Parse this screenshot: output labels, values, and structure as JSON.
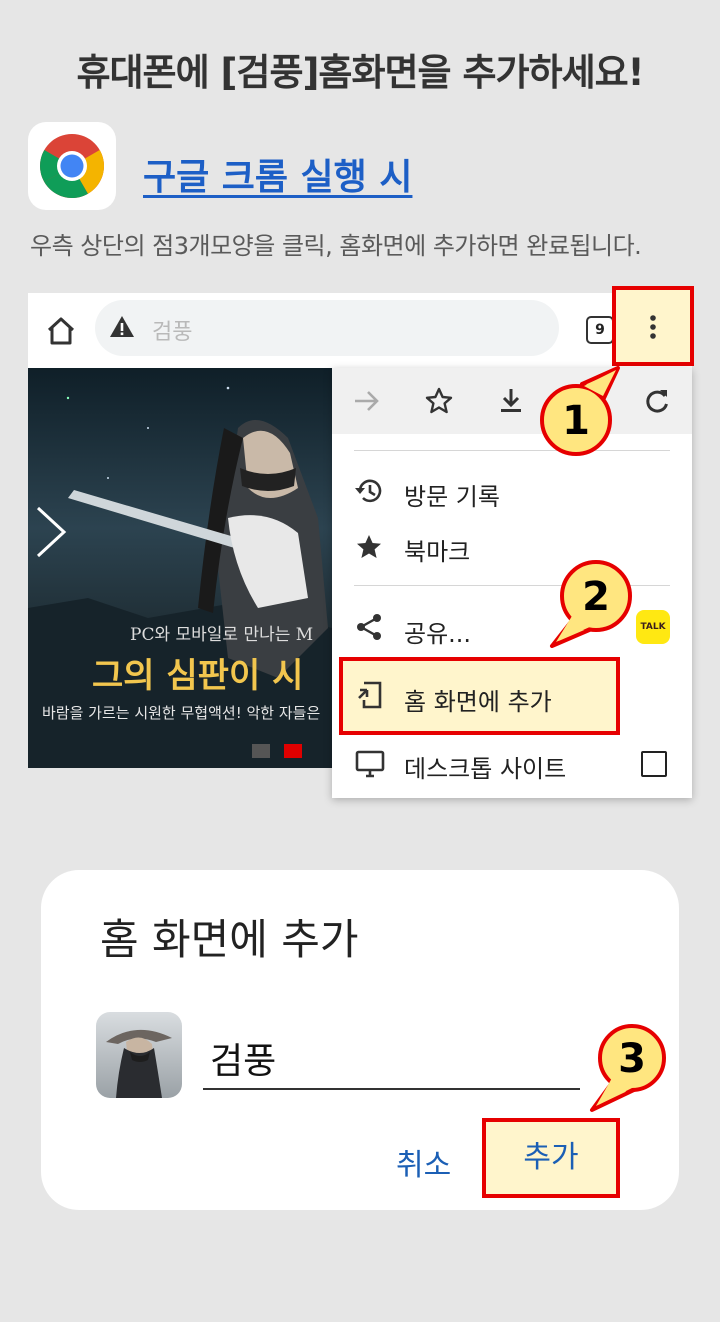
{
  "header": {
    "title": "휴대폰에 [검풍]홈화면을 추가하세요!"
  },
  "section": {
    "icon": "chrome-logo",
    "heading": "구글 크롬 실행 시",
    "instruction": "우측 상단의 점3개모양을 클릭, 홈화면에 추가하면 완료됩니다."
  },
  "browser": {
    "address_text": "검풍",
    "tab_count": "9",
    "icons": [
      "home-icon",
      "warning-icon",
      "more-vert-icon"
    ]
  },
  "banner": {
    "line1": "PC와 모바일로 만나는 M",
    "line2": "그의 심판이 시",
    "line3": "바람을 가르는 시원한 무협액션! 악한 자들은"
  },
  "menu": {
    "toolbar_icons": [
      "forward-icon",
      "star-icon",
      "download-icon",
      "refresh-icon"
    ],
    "items": [
      {
        "label": "방문 기록",
        "icon": "history-icon"
      },
      {
        "label": "북마크",
        "icon": "star-icon"
      },
      {
        "label": "공유...",
        "icon": "share-icon"
      },
      {
        "label": "홈 화면에 추가",
        "icon": "add-to-home-icon"
      },
      {
        "label": "데스크톱 사이트",
        "icon": "desktop-icon"
      }
    ],
    "kakao_label": "TALK"
  },
  "steps": [
    "1",
    "2",
    "3"
  ],
  "dialog": {
    "title": "홈 화면에 추가",
    "name_value": "검풍",
    "cancel_label": "취소",
    "add_label": "추가"
  },
  "colors": {
    "background": "#e6e6e6",
    "accent_red": "#e60000",
    "highlight_yellow": "#fff5cc",
    "link_blue": "#1d5fc6",
    "badge_yellow": "#ffe680"
  }
}
